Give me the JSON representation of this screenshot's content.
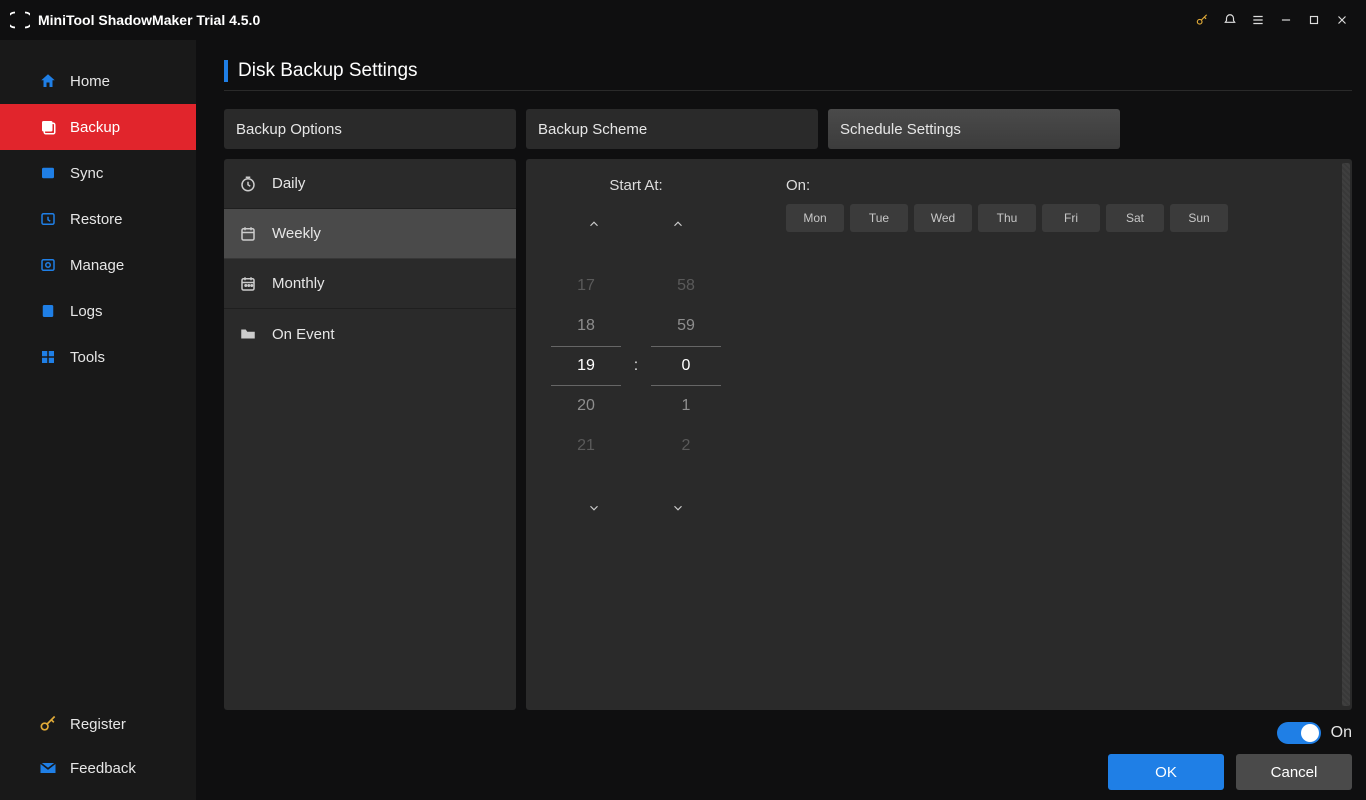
{
  "app": {
    "title": "MiniTool ShadowMaker Trial 4.5.0"
  },
  "sidebar": {
    "items": [
      {
        "label": "Home"
      },
      {
        "label": "Backup"
      },
      {
        "label": "Sync"
      },
      {
        "label": "Restore"
      },
      {
        "label": "Manage"
      },
      {
        "label": "Logs"
      },
      {
        "label": "Tools"
      }
    ],
    "footer": {
      "register": "Register",
      "feedback": "Feedback"
    }
  },
  "page": {
    "title": "Disk Backup Settings"
  },
  "tabs": {
    "options": "Backup Options",
    "scheme": "Backup Scheme",
    "schedule": "Schedule Settings"
  },
  "freq": {
    "daily": "Daily",
    "weekly": "Weekly",
    "monthly": "Monthly",
    "onevent": "On Event"
  },
  "schedule": {
    "start_at_label": "Start At:",
    "on_label": "On:",
    "hours": [
      "17",
      "18",
      "19",
      "20",
      "21"
    ],
    "minutes": [
      "58",
      "59",
      "0",
      "1",
      "2"
    ],
    "days": [
      "Mon",
      "Tue",
      "Wed",
      "Thu",
      "Fri",
      "Sat",
      "Sun"
    ]
  },
  "footer": {
    "toggle_label": "On",
    "ok": "OK",
    "cancel": "Cancel"
  }
}
